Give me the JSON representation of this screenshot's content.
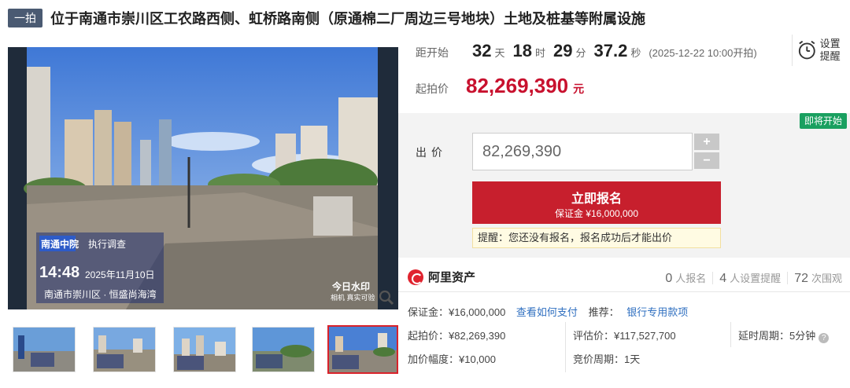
{
  "header": {
    "tag": "一拍",
    "title": "位于南通市崇川区工农路西侧、虹桥路南侧（原通棉二厂周边三号地块）土地及桩基等附属设施"
  },
  "photo": {
    "overlay_tag": "南通中院",
    "overlay_action": "执行调查",
    "overlay_time": "14:48",
    "overlay_date": "2025年11月10日",
    "overlay_location": "南通市崇川区 · 恒盛尚海湾",
    "watermark": "今日水印",
    "watermark_sub": "相机 真实可验"
  },
  "countdown": {
    "label": "距开始",
    "days": "32",
    "days_unit": "天",
    "hours": "18",
    "hours_unit": "时",
    "minutes": "29",
    "minutes_unit": "分",
    "seconds": "37.2",
    "seconds_unit": "秒",
    "start_time": "(2025-12-22 10:00开拍)"
  },
  "reminder": {
    "label": "设置提醒"
  },
  "start_price": {
    "label": "起拍价",
    "value": "82,269,390",
    "unit": "元"
  },
  "bid": {
    "status_badge": "即将开始",
    "label": "出价",
    "value": "82,269,390",
    "plus": "+",
    "minus": "−",
    "signup_label": "立即报名",
    "deposit_label": "保证金 ¥16,000,000",
    "tip": "提醒：您还没有报名，报名成功后才能出价"
  },
  "brand": {
    "name": "阿里资产"
  },
  "stats": {
    "signups": "0",
    "signups_label": "人报名",
    "reminders": "4",
    "reminders_label": "人设置提醒",
    "views": "72",
    "views_label": "次围观"
  },
  "details": {
    "deposit": "保证金：¥16,000,000",
    "how_to_pay": "查看如何支付",
    "recommend_label": "推荐：",
    "recommend_link": "银行专用款项",
    "start_price": "起拍价：¥82,269,390",
    "appraisal": "评估价：¥117,527,700",
    "delay": "延时周期：5分钟",
    "increment": "加价幅度：¥10,000",
    "bid_cycle": "竞价周期：1天"
  },
  "colors": {
    "accent": "#c8112e",
    "badge": "#1aa060",
    "link": "#2f6fc0"
  }
}
